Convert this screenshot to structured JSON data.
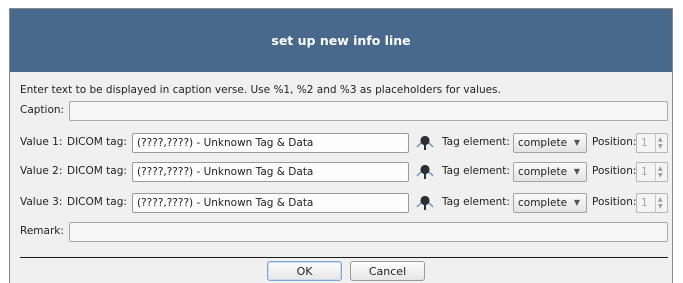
{
  "dialog": {
    "title": "set up new info line",
    "instruction": "Enter text to be displayed in caption verse. Use %1, %2 and %3 as placeholders for values.",
    "caption": {
      "label": "Caption:",
      "value": ""
    },
    "values": [
      {
        "label": "Value 1:",
        "dicom_label": "DICOM tag:",
        "tag_value": "(????,????) - Unknown Tag & Data",
        "tag_element_label": "Tag element:",
        "tag_element": "complete",
        "position_label": "Position:",
        "position": "1"
      },
      {
        "label": "Value 2:",
        "dicom_label": "DICOM tag:",
        "tag_value": "(????,????) - Unknown Tag & Data",
        "tag_element_label": "Tag element:",
        "tag_element": "complete",
        "position_label": "Position:",
        "position": "1"
      },
      {
        "label": "Value 3:",
        "dicom_label": "DICOM tag:",
        "tag_value": "(????,????) - Unknown Tag & Data",
        "tag_element_label": "Tag element:",
        "tag_element": "complete",
        "position_label": "Position:",
        "position": "1"
      }
    ],
    "remark": {
      "label": "Remark:",
      "value": ""
    },
    "buttons": {
      "ok": "OK",
      "cancel": "Cancel"
    }
  },
  "icons": {
    "picker": "eyedropper-icon",
    "dropdown": "chevron-down-icon",
    "spin_up": "arrow-up-icon",
    "spin_down": "arrow-down-icon"
  },
  "colors": {
    "titlebar": "#49698c",
    "title_text": "#ffffff",
    "dialog_bg": "#f0f0f0"
  }
}
